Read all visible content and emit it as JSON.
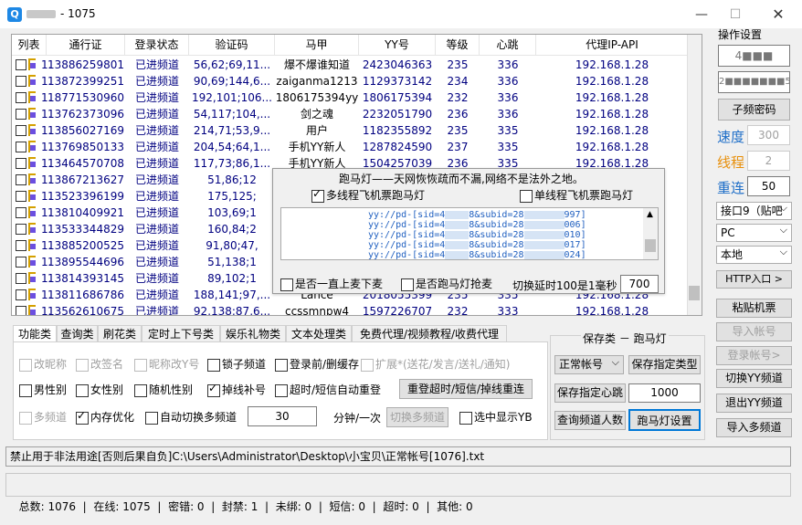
{
  "window": {
    "title": "- 1075",
    "app_icon": "Q"
  },
  "table": {
    "headers": [
      "列表",
      "通行证",
      "登录状态",
      "验证码",
      "马甲",
      "YY号",
      "等级",
      "心跳",
      "代理IP-API"
    ],
    "rows": [
      {
        "idx": "1...",
        "id": "13886259801",
        "status": "已进频道",
        "code": "56,62;69,11...",
        "nick": "爆不爆谁知道",
        "yy": "2423046363",
        "level": "235",
        "hb": "336",
        "ip": "192.168.1.28"
      },
      {
        "idx": "1...",
        "id": "13872399251",
        "status": "已进频道",
        "code": "90,69;144,6...",
        "nick": "zaiganma1213",
        "yy": "1129373142",
        "level": "234",
        "hb": "336",
        "ip": "192.168.1.28"
      },
      {
        "idx": "1...",
        "id": "18771530960",
        "status": "已进频道",
        "code": "192,101;106...",
        "nick": "1806175394yy",
        "yy": "1806175394",
        "level": "232",
        "hb": "336",
        "ip": "192.168.1.28"
      },
      {
        "idx": "1...",
        "id": "13762373096",
        "status": "已进频道",
        "code": "54,117;104,...",
        "nick": "剑之魂",
        "yy": "2232051790",
        "level": "236",
        "hb": "336",
        "ip": "192.168.1.28"
      },
      {
        "idx": "1...",
        "id": "13856027169",
        "status": "已进频道",
        "code": "214,71;53,9...",
        "nick": "用户",
        "yy": "1182355892",
        "level": "235",
        "hb": "335",
        "ip": "192.168.1.28"
      },
      {
        "idx": "1...",
        "id": "13769850133",
        "status": "已进频道",
        "code": "204,54;64,1...",
        "nick": "手机YY新人",
        "yy": "1287824590",
        "level": "237",
        "hb": "335",
        "ip": "192.168.1.28"
      },
      {
        "idx": "1...",
        "id": "13464570708",
        "status": "已进频道",
        "code": "117,73;86,1...",
        "nick": "手机YY新人",
        "yy": "1504257039",
        "level": "236",
        "hb": "335",
        "ip": "192.168.1.28"
      },
      {
        "idx": "1...",
        "id": "13867213627",
        "status": "已进频道",
        "code": "51,86;12",
        "nick": "",
        "yy": "",
        "level": "",
        "hb": "",
        "ip": ""
      },
      {
        "idx": "1...",
        "id": "13523396199",
        "status": "已进频道",
        "code": "175,125;",
        "nick": "",
        "yy": "",
        "level": "",
        "hb": "",
        "ip": ""
      },
      {
        "idx": "1...",
        "id": "13810409921",
        "status": "已进频道",
        "code": "103,69;1",
        "nick": "",
        "yy": "",
        "level": "",
        "hb": "",
        "ip": ""
      },
      {
        "idx": "1...",
        "id": "13533344829",
        "status": "已进频道",
        "code": "160,84;2",
        "nick": "",
        "yy": "",
        "level": "",
        "hb": "",
        "ip": ""
      },
      {
        "idx": "1...",
        "id": "13885200525",
        "status": "已进频道",
        "code": "91,80;47,",
        "nick": "",
        "yy": "",
        "level": "",
        "hb": "",
        "ip": ""
      },
      {
        "idx": "1...",
        "id": "13895544696",
        "status": "已进频道",
        "code": "51,138;1",
        "nick": "",
        "yy": "",
        "level": "",
        "hb": "",
        "ip": ""
      },
      {
        "idx": "1...",
        "id": "13814393145",
        "status": "已进频道",
        "code": "89,102;1",
        "nick": "",
        "yy": "",
        "level": "",
        "hb": "",
        "ip": ""
      },
      {
        "idx": "1...",
        "id": "13811686786",
        "status": "已进频道",
        "code": "188,141;97,...",
        "nick": "Lance",
        "yy": "2018055399",
        "level": "235",
        "hb": "335",
        "ip": "192.168.1.28"
      },
      {
        "idx": "1...",
        "id": "13562610675",
        "status": "已进频道",
        "code": "92,138;87,6...",
        "nick": "ccssmnpw4",
        "yy": "1597226707",
        "level": "232",
        "hb": "333",
        "ip": "192.168.1.28"
      }
    ]
  },
  "settings": {
    "title": "操作设置",
    "field1": "4■■■",
    "field2": "2■■■■■■■5",
    "subchannel_password": "子频密码",
    "speed_label": "速度",
    "speed_value": "300",
    "threads_label": "线程",
    "threads_value": "2",
    "reconnect_label": "重连",
    "reconnect_value": "50",
    "port_select": "接口9（贴吧",
    "platform_select": "PC",
    "locale_select": "本地",
    "http_entry": "HTTP入口 >",
    "paste_ticket": "粘贴机票",
    "import_account": "导入帐号",
    "login_account": "登录帐号>",
    "switch_yy": "切换YY频道",
    "exit_yy": "退出YY频道",
    "import_multi": "导入多频道"
  },
  "popup": {
    "title": "跑马灯——天网恢恢疏而不漏,网络不是法外之地。",
    "multi_thread": "多线程飞机票跑马灯",
    "single_thread": "单线程飞机票跑马灯",
    "lines": [
      "yy://pd-[sid=4",
      "yy://pd-[sid=4",
      "yy://pd-[sid=4",
      "yy://pd-[sid=4",
      "yy://pd-[sid=4"
    ],
    "line_mid": "8&subid=28",
    "line_ends": [
      "997]",
      "006]",
      "010]",
      "017]",
      "024]"
    ],
    "always_on_mic": "是否一直上麦下麦",
    "grab_mic": "是否跑马灯抢麦",
    "delay_label": "切换延时100是1毫秒",
    "delay_value": "700"
  },
  "tabs": [
    "功能类",
    "查询类",
    "刷花类",
    "定时上下号类",
    "娱乐礼物类",
    "文本处理类",
    "免费代理/视频教程/收费代理"
  ],
  "function_tab": {
    "rename_nick": "改昵称",
    "rename_sign": "改签名",
    "nick_yy": "昵称改Y号",
    "lock_channel": "锁子频道",
    "delete_cache": "登录前/删缓存",
    "expand": "扩展*(送花/发言/送礼/通知)",
    "male": "男性别",
    "female": "女性别",
    "random_gender": "随机性别",
    "drop_relogin": "掉线补号",
    "timeout_reconnect": "超时/短信自动重登",
    "reset_btn": "重登超时/短信/掉线重连",
    "multi_channel": "多频道",
    "mem_opt": "内存优化",
    "auto_switch": "自动切换多频道",
    "minutes_value": "30",
    "per_min": "分钟/一次",
    "switch_multi_btn": "切换多频道",
    "show_yb": "选中显示YB"
  },
  "group": {
    "title": "保存类 － 跑马灯",
    "normal_account": "正常帐号",
    "save_type": "保存指定类型",
    "save_hb": "保存指定心跳",
    "hb_value": "1000",
    "query_count": "查询频道人数",
    "marquee_settings": "跑马灯设置"
  },
  "path_text": "禁止用于非法用途[否则后果自负]C:\\Users\\Administrator\\Desktop\\小宝贝\\正常帐号[1076].txt",
  "status": {
    "total": "总数: 1076",
    "online": "在线: 1075",
    "password": "密错: 0",
    "banned": "封禁: 1",
    "unbound": "未绑: 0",
    "sms": "短信: 0",
    "timeout": "超时: 0",
    "other": "其他: 0"
  }
}
